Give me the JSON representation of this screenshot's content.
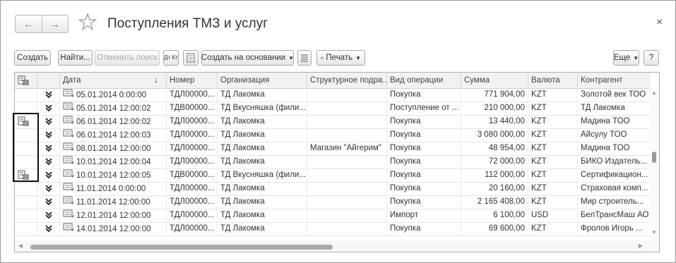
{
  "window": {
    "title": "Поступления ТМЗ и услуг",
    "back_icon": "←",
    "forward_icon": "→",
    "close_icon": "×"
  },
  "toolbar": {
    "create": "Создать",
    "find": "Найти...",
    "cancel_search": "Отменить поиск",
    "dt_kt": "Дт Кт",
    "create_based_on": "Создать на основании",
    "print": "Печать",
    "more": "Еще",
    "help": "?"
  },
  "table": {
    "columns": [
      "",
      "",
      "Дата",
      "Номер",
      "Организация",
      "Структурное подра...",
      "Вид операции",
      "Сумма",
      "Валюта",
      "Контрагент"
    ],
    "sort_indicator": "↓",
    "rows": [
      {
        "flag": false,
        "date": "05.01.2014 0:00:00",
        "number": "ТДЛ00000...",
        "org": "ТД Лакомка",
        "subdiv": "",
        "operation": "Покупка",
        "sum": "771 904,00",
        "currency": "KZT",
        "counterparty": "Золотой век ТОО"
      },
      {
        "flag": false,
        "date": "05.01.2014 12:00:02",
        "number": "ТДВ00000...",
        "org": "ТД Вкусняшка (фили...",
        "subdiv": "",
        "operation": "Поступление от ...",
        "sum": "210 000,00",
        "currency": "KZT",
        "counterparty": "ТД Лакомка"
      },
      {
        "flag": true,
        "date": "06.01.2014 12:00:02",
        "number": "ТДЛ00000...",
        "org": "ТД Лакомка",
        "subdiv": "",
        "operation": "Покупка",
        "sum": "13 440,00",
        "currency": "KZT",
        "counterparty": "Мадина ТОО"
      },
      {
        "flag": false,
        "date": "06.01.2014 12:00:03",
        "number": "ТДЛ00000...",
        "org": "ТД Лакомка",
        "subdiv": "",
        "operation": "Покупка",
        "sum": "3 080 000,00",
        "currency": "KZT",
        "counterparty": "Айсулу ТОО"
      },
      {
        "flag": false,
        "date": "08.01.2014 12:00:00",
        "number": "ТДЛ00000...",
        "org": "ТД Лакомка",
        "subdiv": "Магазин \"Айгерим\"",
        "operation": "Покупка",
        "sum": "48 954,00",
        "currency": "KZT",
        "counterparty": "Мадина ТОО"
      },
      {
        "flag": false,
        "date": "10.01.2014 12:00:04",
        "number": "ТДЛ00000...",
        "org": "ТД Лакомка",
        "subdiv": "",
        "operation": "Покупка",
        "sum": "72 000,00",
        "currency": "KZT",
        "counterparty": "БИКО Издатель..."
      },
      {
        "flag": true,
        "date": "10.01.2014 12:00:05",
        "number": "ТДВ00000...",
        "org": "ТД Вкусняшка (фили...",
        "subdiv": "",
        "operation": "Покупка",
        "sum": "112 000,00",
        "currency": "KZT",
        "counterparty": "Сертификацион..."
      },
      {
        "flag": false,
        "date": "11.01.2014 0:00:00",
        "number": "ТДЛ00000...",
        "org": "ТД Лакомка",
        "subdiv": "",
        "operation": "Покупка",
        "sum": "20 160,00",
        "currency": "KZT",
        "counterparty": "Страховая комп..."
      },
      {
        "flag": false,
        "date": "11.01.2014 12:00:00",
        "number": "ТДЛ00000...",
        "org": "ТД Лакомка",
        "subdiv": "",
        "operation": "Покупка",
        "sum": "2 165 408,00",
        "currency": "KZT",
        "counterparty": "Мир строитель..."
      },
      {
        "flag": false,
        "date": "12.01.2014 12:00:00",
        "number": "ТДЛ00000...",
        "org": "ТД Лакомка",
        "subdiv": "",
        "operation": "Импорт",
        "sum": "6 100,00",
        "currency": "USD",
        "counterparty": "БелТрансМаш АО"
      },
      {
        "flag": false,
        "date": "14.01.2014 12:00:00",
        "number": "ТДЛ00000...",
        "org": "ТД Лакомка",
        "subdiv": "",
        "operation": "Покупка",
        "sum": "69 600,00",
        "currency": "KZT",
        "counterparty": "Фролов Игорь ..."
      }
    ]
  }
}
